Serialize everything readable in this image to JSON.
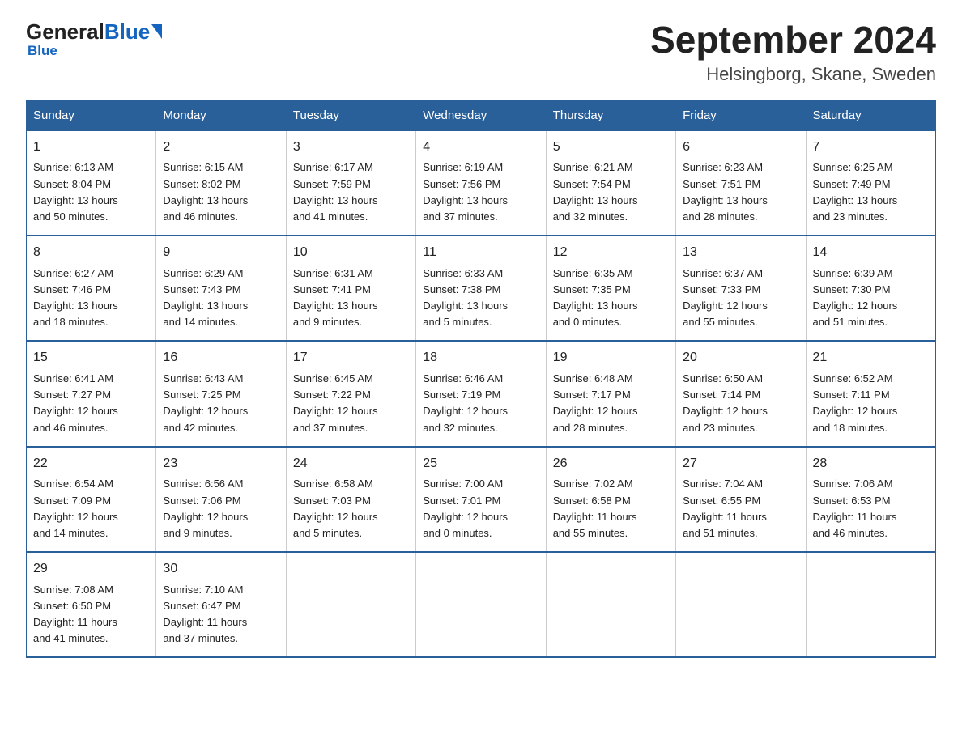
{
  "header": {
    "logo_general": "General",
    "logo_blue": "Blue",
    "title": "September 2024",
    "subtitle": "Helsingborg, Skane, Sweden"
  },
  "weekdays": [
    "Sunday",
    "Monday",
    "Tuesday",
    "Wednesday",
    "Thursday",
    "Friday",
    "Saturday"
  ],
  "weeks": [
    [
      {
        "day": "1",
        "info": "Sunrise: 6:13 AM\nSunset: 8:04 PM\nDaylight: 13 hours\nand 50 minutes."
      },
      {
        "day": "2",
        "info": "Sunrise: 6:15 AM\nSunset: 8:02 PM\nDaylight: 13 hours\nand 46 minutes."
      },
      {
        "day": "3",
        "info": "Sunrise: 6:17 AM\nSunset: 7:59 PM\nDaylight: 13 hours\nand 41 minutes."
      },
      {
        "day": "4",
        "info": "Sunrise: 6:19 AM\nSunset: 7:56 PM\nDaylight: 13 hours\nand 37 minutes."
      },
      {
        "day": "5",
        "info": "Sunrise: 6:21 AM\nSunset: 7:54 PM\nDaylight: 13 hours\nand 32 minutes."
      },
      {
        "day": "6",
        "info": "Sunrise: 6:23 AM\nSunset: 7:51 PM\nDaylight: 13 hours\nand 28 minutes."
      },
      {
        "day": "7",
        "info": "Sunrise: 6:25 AM\nSunset: 7:49 PM\nDaylight: 13 hours\nand 23 minutes."
      }
    ],
    [
      {
        "day": "8",
        "info": "Sunrise: 6:27 AM\nSunset: 7:46 PM\nDaylight: 13 hours\nand 18 minutes."
      },
      {
        "day": "9",
        "info": "Sunrise: 6:29 AM\nSunset: 7:43 PM\nDaylight: 13 hours\nand 14 minutes."
      },
      {
        "day": "10",
        "info": "Sunrise: 6:31 AM\nSunset: 7:41 PM\nDaylight: 13 hours\nand 9 minutes."
      },
      {
        "day": "11",
        "info": "Sunrise: 6:33 AM\nSunset: 7:38 PM\nDaylight: 13 hours\nand 5 minutes."
      },
      {
        "day": "12",
        "info": "Sunrise: 6:35 AM\nSunset: 7:35 PM\nDaylight: 13 hours\nand 0 minutes."
      },
      {
        "day": "13",
        "info": "Sunrise: 6:37 AM\nSunset: 7:33 PM\nDaylight: 12 hours\nand 55 minutes."
      },
      {
        "day": "14",
        "info": "Sunrise: 6:39 AM\nSunset: 7:30 PM\nDaylight: 12 hours\nand 51 minutes."
      }
    ],
    [
      {
        "day": "15",
        "info": "Sunrise: 6:41 AM\nSunset: 7:27 PM\nDaylight: 12 hours\nand 46 minutes."
      },
      {
        "day": "16",
        "info": "Sunrise: 6:43 AM\nSunset: 7:25 PM\nDaylight: 12 hours\nand 42 minutes."
      },
      {
        "day": "17",
        "info": "Sunrise: 6:45 AM\nSunset: 7:22 PM\nDaylight: 12 hours\nand 37 minutes."
      },
      {
        "day": "18",
        "info": "Sunrise: 6:46 AM\nSunset: 7:19 PM\nDaylight: 12 hours\nand 32 minutes."
      },
      {
        "day": "19",
        "info": "Sunrise: 6:48 AM\nSunset: 7:17 PM\nDaylight: 12 hours\nand 28 minutes."
      },
      {
        "day": "20",
        "info": "Sunrise: 6:50 AM\nSunset: 7:14 PM\nDaylight: 12 hours\nand 23 minutes."
      },
      {
        "day": "21",
        "info": "Sunrise: 6:52 AM\nSunset: 7:11 PM\nDaylight: 12 hours\nand 18 minutes."
      }
    ],
    [
      {
        "day": "22",
        "info": "Sunrise: 6:54 AM\nSunset: 7:09 PM\nDaylight: 12 hours\nand 14 minutes."
      },
      {
        "day": "23",
        "info": "Sunrise: 6:56 AM\nSunset: 7:06 PM\nDaylight: 12 hours\nand 9 minutes."
      },
      {
        "day": "24",
        "info": "Sunrise: 6:58 AM\nSunset: 7:03 PM\nDaylight: 12 hours\nand 5 minutes."
      },
      {
        "day": "25",
        "info": "Sunrise: 7:00 AM\nSunset: 7:01 PM\nDaylight: 12 hours\nand 0 minutes."
      },
      {
        "day": "26",
        "info": "Sunrise: 7:02 AM\nSunset: 6:58 PM\nDaylight: 11 hours\nand 55 minutes."
      },
      {
        "day": "27",
        "info": "Sunrise: 7:04 AM\nSunset: 6:55 PM\nDaylight: 11 hours\nand 51 minutes."
      },
      {
        "day": "28",
        "info": "Sunrise: 7:06 AM\nSunset: 6:53 PM\nDaylight: 11 hours\nand 46 minutes."
      }
    ],
    [
      {
        "day": "29",
        "info": "Sunrise: 7:08 AM\nSunset: 6:50 PM\nDaylight: 11 hours\nand 41 minutes."
      },
      {
        "day": "30",
        "info": "Sunrise: 7:10 AM\nSunset: 6:47 PM\nDaylight: 11 hours\nand 37 minutes."
      },
      {
        "day": "",
        "info": ""
      },
      {
        "day": "",
        "info": ""
      },
      {
        "day": "",
        "info": ""
      },
      {
        "day": "",
        "info": ""
      },
      {
        "day": "",
        "info": ""
      }
    ]
  ]
}
